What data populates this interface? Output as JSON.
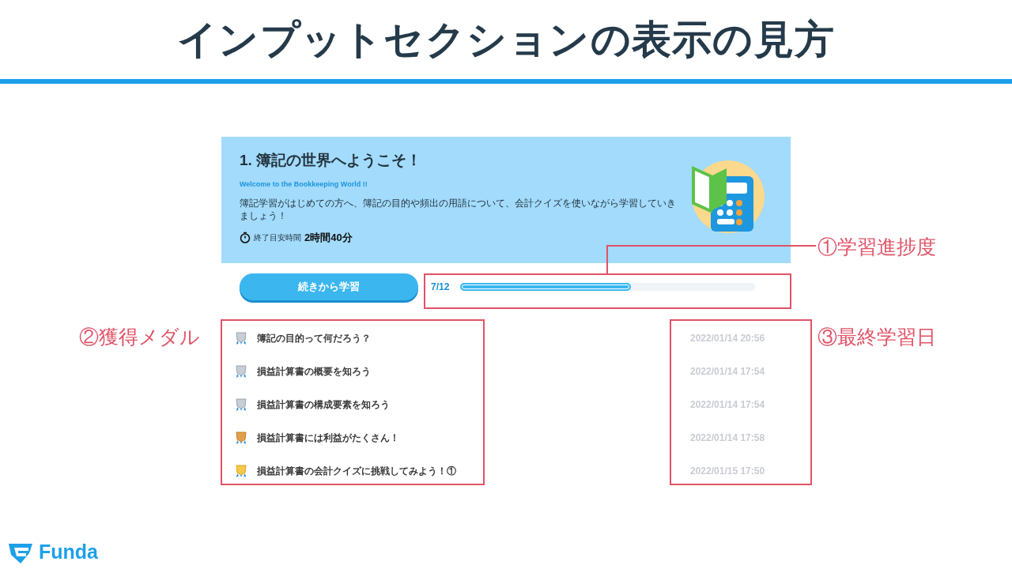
{
  "slide_title": "インプットセクションの表示の見方",
  "course": {
    "title": "1. 簿記の世界へようこそ！",
    "subtitle": "Welcome to the Bookkeeping World !!",
    "description": "簿記学習がはじめての方へ、簿記の目的や頻出の用語について、会計クイズを使いながら学習していきましょう！",
    "time_label": "終了目安時間",
    "time_value": "2時間40分"
  },
  "continue_button": "続きから学習",
  "progress": {
    "reading": "7/12",
    "level": 0.58
  },
  "lessons": [
    {
      "title": "簿記の目的って何だろう？",
      "kind": "silver",
      "date": "2022/01/14 20:56"
    },
    {
      "title": "損益計算書の概要を知ろう",
      "kind": "silver",
      "date": "2022/01/14 17:54"
    },
    {
      "title": "損益計算書の構成要素を知ろう",
      "kind": "silver",
      "date": "2022/01/14 17:54"
    },
    {
      "title": "損益計算書には利益がたくさん！",
      "kind": "bronze",
      "date": "2022/01/14 17:58"
    },
    {
      "title": "損益計算書の会計クイズに挑戦してみよう！①",
      "kind": "gold",
      "date": "2022/01/15 17:50"
    }
  ],
  "annotations": {
    "progress": "①学習進捗度",
    "medals": "②獲得メダル",
    "dates": "③最終学習日"
  },
  "logo": "Funda"
}
